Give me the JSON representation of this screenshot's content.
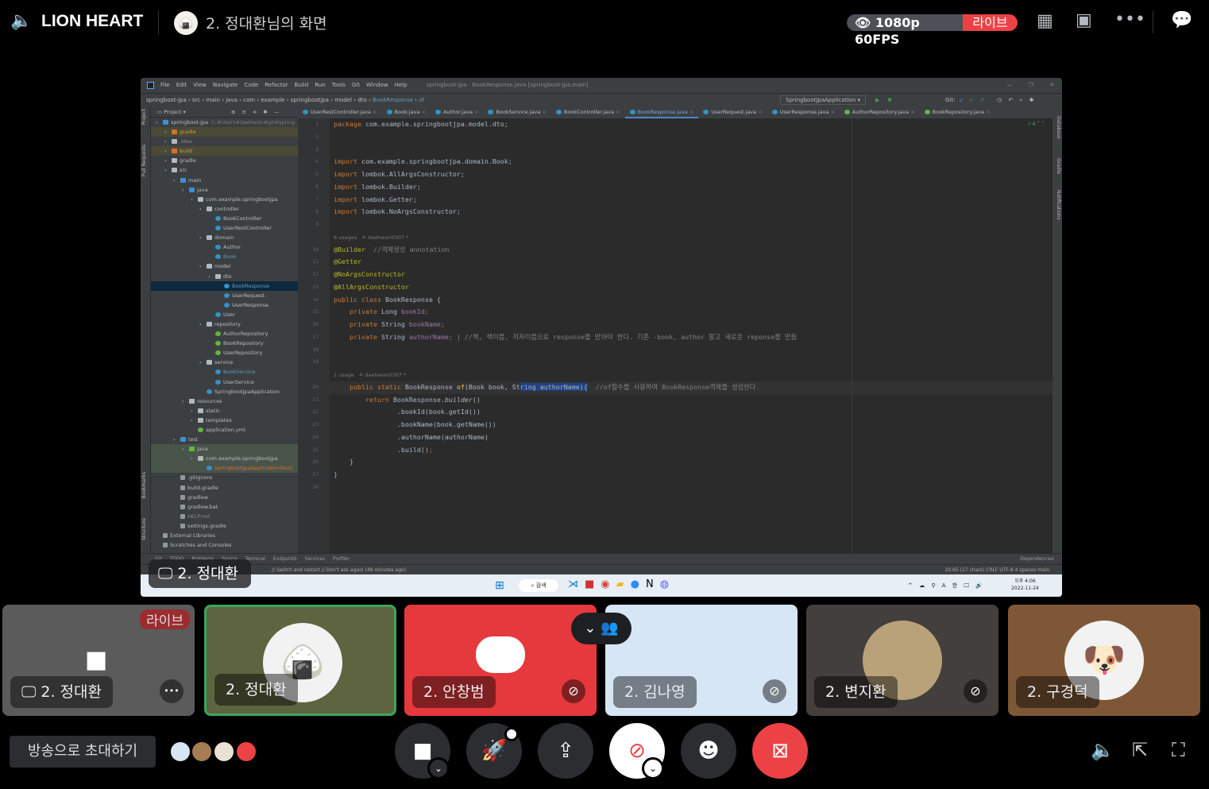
{
  "topbar": {
    "server_name": "LION HEART",
    "stream_title": "2. 정대환님의 화면",
    "quality": "1080p 60FPS",
    "live": "라이브",
    "icons": [
      "speaker-lock-icon",
      "grid-icon",
      "inbox-icon",
      "more-icon",
      "chat-icon"
    ]
  },
  "ide": {
    "menu": [
      "File",
      "Edit",
      "View",
      "Navigate",
      "Code",
      "Refactor",
      "Build",
      "Run",
      "Tools",
      "Git",
      "Window",
      "Help"
    ],
    "window_title": "springboot-jpa - BookResponse.java [springboot-jpa.main]",
    "breadcrumb": [
      "springboot-jpa",
      "src",
      "main",
      "java",
      "com",
      "example",
      "springbootjpa",
      "model",
      "dto",
      "BookResponse",
      "of"
    ],
    "run_config": "SpringbootJpaApplication",
    "git_label": "Git:",
    "project_label": "Project",
    "side_left": [
      "Project",
      "Pull Requests",
      "Bookmarks",
      "Structure"
    ],
    "side_right": [
      "Database",
      "Gradle",
      "Notifications"
    ],
    "tabs": [
      {
        "label": "UserRestController.java",
        "kind": "cls"
      },
      {
        "label": "Book.java",
        "kind": "cls"
      },
      {
        "label": "Author.java",
        "kind": "cls"
      },
      {
        "label": "BookService.java",
        "kind": "cls"
      },
      {
        "label": "BookController.java",
        "kind": "cls"
      },
      {
        "label": "BookResponse.java",
        "kind": "cls",
        "active": true
      },
      {
        "label": "UserRequest.java",
        "kind": "cls"
      },
      {
        "label": "UserResponse.java",
        "kind": "cls"
      },
      {
        "label": "AuthorRepository.java",
        "kind": "int"
      },
      {
        "label": "BookRepository.java",
        "kind": "int"
      }
    ],
    "tree": [
      {
        "d": 0,
        "l": "springboot-jpa",
        "i": "jdir",
        "x": "C:#Users#daehwan#git#spring"
      },
      {
        "d": 1,
        "l": "gradle",
        "i": "odir",
        "s": "ign",
        "c": "#c8a03c"
      },
      {
        "d": 1,
        "l": ".idea",
        "i": "dir",
        "c": "#888"
      },
      {
        "d": 1,
        "l": "build",
        "i": "odir",
        "s": "ign",
        "c": "#c8a03c"
      },
      {
        "d": 1,
        "l": "gradle",
        "i": "dir"
      },
      {
        "d": 1,
        "l": "src",
        "i": "dir"
      },
      {
        "d": 2,
        "l": "main",
        "i": "jdir"
      },
      {
        "d": 3,
        "l": "java",
        "i": "jdir"
      },
      {
        "d": 4,
        "l": "com.example.springbootjpa",
        "i": "dir"
      },
      {
        "d": 5,
        "l": "controller",
        "i": "dir"
      },
      {
        "d": 6,
        "l": "BookController",
        "i": "cls"
      },
      {
        "d": 6,
        "l": "UserRestController",
        "i": "cls"
      },
      {
        "d": 5,
        "l": "domain",
        "i": "dir"
      },
      {
        "d": 6,
        "l": "Author",
        "i": "cls"
      },
      {
        "d": 6,
        "l": "Book",
        "i": "cls",
        "c": "#6897bb"
      },
      {
        "d": 5,
        "l": "model",
        "i": "dir"
      },
      {
        "d": 6,
        "l": "dto",
        "i": "dir"
      },
      {
        "d": 7,
        "l": "BookResponse",
        "i": "cls",
        "s": "sel",
        "c": "#6897bb"
      },
      {
        "d": 7,
        "l": "UserRequest",
        "i": "cls"
      },
      {
        "d": 7,
        "l": "UserResponse",
        "i": "cls"
      },
      {
        "d": 6,
        "l": "User",
        "i": "cls"
      },
      {
        "d": 5,
        "l": "repository",
        "i": "dir"
      },
      {
        "d": 6,
        "l": "AuthorRepository",
        "i": "int"
      },
      {
        "d": 6,
        "l": "BookRepository",
        "i": "int"
      },
      {
        "d": 6,
        "l": "UserRepository",
        "i": "int"
      },
      {
        "d": 5,
        "l": "service",
        "i": "dir"
      },
      {
        "d": 6,
        "l": "BookService",
        "i": "cls",
        "c": "#6897bb"
      },
      {
        "d": 6,
        "l": "UserService",
        "i": "cls"
      },
      {
        "d": 5,
        "l": "SpringbootJpaApplication",
        "i": "cls"
      },
      {
        "d": 3,
        "l": "resources",
        "i": "dir"
      },
      {
        "d": 4,
        "l": "static",
        "i": "dir"
      },
      {
        "d": 4,
        "l": "templates",
        "i": "dir"
      },
      {
        "d": 4,
        "l": "application.yml",
        "i": "int"
      },
      {
        "d": 2,
        "l": "test",
        "i": "jdir"
      },
      {
        "d": 3,
        "l": "java",
        "i": "gdir",
        "s": "test"
      },
      {
        "d": 4,
        "l": "com.example.springbootjpa",
        "i": "dir",
        "s": "test"
      },
      {
        "d": 5,
        "l": "SpringbootJpaApplicationTests",
        "i": "cls",
        "s": "test",
        "c": "#d86f2b"
      },
      {
        "d": 2,
        "l": ".gitignore",
        "i": "file"
      },
      {
        "d": 2,
        "l": "build.gradle",
        "i": "file"
      },
      {
        "d": 2,
        "l": "gradlew",
        "i": "file"
      },
      {
        "d": 2,
        "l": "gradlew.bat",
        "i": "file"
      },
      {
        "d": 2,
        "l": "HELP.md",
        "i": "file",
        "c": "#888"
      },
      {
        "d": 2,
        "l": "settings.gradle",
        "i": "file"
      },
      {
        "d": 0,
        "l": "External Libraries",
        "i": "file"
      },
      {
        "d": 0,
        "l": "Scratches and Consoles",
        "i": "file"
      }
    ],
    "code": [
      {
        "n": "1",
        "t": [
          [
            "package ",
            "kw"
          ],
          [
            "com.example.springbootjpa.model.dto;",
            ""
          ]
        ]
      },
      {
        "n": "2",
        "t": []
      },
      {
        "n": "3",
        "t": []
      },
      {
        "n": "4",
        "t": [
          [
            "import ",
            "kw"
          ],
          [
            "com.example.springbootjpa.domain.Book;",
            ""
          ]
        ]
      },
      {
        "n": "5",
        "t": [
          [
            "import ",
            "kw"
          ],
          [
            "lombok.AllArgsConstructor;",
            ""
          ]
        ]
      },
      {
        "n": "6",
        "t": [
          [
            "import ",
            "kw"
          ],
          [
            "lombok.Builder;",
            ""
          ]
        ]
      },
      {
        "n": "7",
        "t": [
          [
            "import ",
            "kw"
          ],
          [
            "lombok.Getter;",
            ""
          ]
        ]
      },
      {
        "n": "8",
        "t": [
          [
            "import ",
            "kw"
          ],
          [
            "lombok.NoArgsConstructor;",
            ""
          ]
        ]
      },
      {
        "n": "9",
        "t": []
      },
      {
        "hint": "8 usages   ≗ daehwan0307 *"
      },
      {
        "n": "10",
        "t": [
          [
            "@Builder",
            "an"
          ],
          [
            "  //객체생성 annotation",
            "cm"
          ]
        ]
      },
      {
        "n": "11",
        "t": [
          [
            "@Getter",
            "an"
          ]
        ]
      },
      {
        "n": "12",
        "t": [
          [
            "@NoArgsConstructor",
            "an"
          ]
        ]
      },
      {
        "n": "13",
        "t": [
          [
            "@AllArgsConstructor",
            "an"
          ]
        ]
      },
      {
        "n": "14",
        "t": [
          [
            "public class ",
            "kw"
          ],
          [
            "BookResponse {",
            ""
          ]
        ]
      },
      {
        "n": "15",
        "t": [
          [
            "    private ",
            "kw"
          ],
          [
            "Long ",
            ""
          ],
          [
            "bookId",
            "fd"
          ],
          [
            ";",
            "kw"
          ]
        ]
      },
      {
        "n": "16",
        "t": [
          [
            "    private ",
            "kw"
          ],
          [
            "String ",
            ""
          ],
          [
            "bookName",
            "fd"
          ],
          [
            ";",
            "kw"
          ]
        ]
      },
      {
        "n": "17",
        "t": [
          [
            "    private ",
            "kw"
          ],
          [
            "String ",
            ""
          ],
          [
            "authorName",
            "fd"
          ],
          [
            ";",
            "kw"
          ],
          [
            " | //책, 책이름, 저자이름으로 response를 받아야 한다. 기존 -book, author 말고 새로운 reponse를 만듬",
            "cm"
          ]
        ]
      },
      {
        "n": "18",
        "t": []
      },
      {
        "n": "19",
        "t": []
      },
      {
        "hint": "1 usage   ≗ daehwan0307 *"
      },
      {
        "n": "20",
        "cur": true,
        "t": [
          [
            "    public static ",
            "kw"
          ],
          [
            "BookResponse ",
            ""
          ],
          [
            "of",
            "mt"
          ],
          [
            "(Book book, St",
            ""
          ],
          [
            "ring authorName){",
            "sel"
          ],
          [
            "  //of함수를 사용하여 BookResponse객체를 생성한다.",
            "cm"
          ]
        ]
      },
      {
        "n": "21",
        "t": [
          [
            "        return ",
            "kw"
          ],
          [
            "BookResponse.",
            ""
          ],
          [
            "builder",
            "it"
          ],
          [
            "()",
            ""
          ]
        ]
      },
      {
        "n": "22",
        "t": [
          [
            "                .bookId(book.getId())",
            ""
          ]
        ]
      },
      {
        "n": "23",
        "t": [
          [
            "                .bookName(book.getName())",
            ""
          ]
        ]
      },
      {
        "n": "24",
        "t": [
          [
            "                .authorName(authorName)",
            ""
          ]
        ]
      },
      {
        "n": "25",
        "t": [
          [
            "                .build()",
            ""
          ],
          [
            ";",
            "kw"
          ]
        ]
      },
      {
        "n": "26",
        "t": [
          [
            "    }",
            ""
          ]
        ]
      },
      {
        "n": "27",
        "t": [
          [
            "}",
            ""
          ]
        ]
      },
      {
        "n": "28",
        "t": []
      }
    ],
    "tool_windows": [
      "Git",
      "TODO",
      "Problems",
      "Spring",
      "Terminal",
      "Endpoints",
      "Services",
      "Profiler"
    ],
    "dependencies": "Dependencies",
    "status_msg": "// Switch and restart // Don't ask again (49 minutes ago)",
    "status_right": "20:65 (17 chars)  CRLF  UTF-8  4 spaces  main",
    "warnings": "✓4",
    "taskbar": {
      "search": "검색",
      "time": "오후 4:06",
      "date": "2022-11-24",
      "lang1": "A",
      "lang2": "한"
    },
    "stream_label": "2. 정대환"
  },
  "tiles": [
    {
      "name": "2. 정대환",
      "bg": "#5b5b5b",
      "badge": "라이브",
      "kind": "screen"
    },
    {
      "name": "2. 정대환",
      "bg": "#5e6440",
      "kind": "speaking"
    },
    {
      "name": "2. 안창범",
      "bg": "#e5393d",
      "kind": "discord",
      "muted": true
    },
    {
      "name": "2. 김나영",
      "bg": "#d6e6f5",
      "kind": "blank",
      "muted": true
    },
    {
      "name": "2. 변지환",
      "bg": "#433f3d",
      "kind": "photo",
      "muted": true
    },
    {
      "name": "2. 구경덕",
      "bg": "#7e5836",
      "kind": "dog"
    }
  ],
  "bottom": {
    "invite": "방송으로 초대하기",
    "controls": [
      "camera",
      "activity",
      "share-screen",
      "mute",
      "emoji",
      "stop-stream"
    ],
    "right_icons": [
      "volume-icon",
      "popout-icon",
      "fullscreen-icon"
    ]
  },
  "colors": {
    "live": "#ed4245",
    "speaking": "#3ba55c",
    "accent_blue": "#4a88c7"
  }
}
